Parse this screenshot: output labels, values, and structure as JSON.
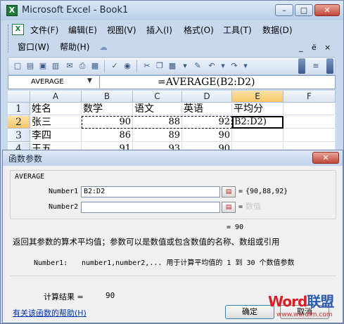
{
  "window": {
    "title": "Microsoft Excel - Book1",
    "icon": "excel-icon"
  },
  "menu": {
    "row1": [
      "文件(F)",
      "编辑(E)",
      "视图(V)",
      "插入(I)",
      "格式(O)",
      "工具(T)",
      "数据(D)"
    ],
    "row2": [
      "窗口(W)",
      "帮助(H)"
    ],
    "doc_controls": [
      "_",
      "ё",
      "×"
    ]
  },
  "formula_bar": {
    "name_box": "AVERAGE",
    "formula": "=AVERAGE(B2:D2)"
  },
  "sheet": {
    "columns": [
      "A",
      "B",
      "C",
      "D",
      "E",
      "F"
    ],
    "rows": [
      "1",
      "2",
      "3",
      "4"
    ],
    "data": [
      [
        "姓名",
        "数学",
        "语文",
        "英语",
        "平均分",
        ""
      ],
      [
        "张三",
        "90",
        "88",
        "92",
        "B2:D2)",
        ""
      ],
      [
        "李四",
        "86",
        "89",
        "90",
        "",
        ""
      ],
      [
        "王五",
        "91",
        "93",
        "90",
        "",
        ""
      ]
    ],
    "selected_column": "E",
    "selected_row": "2"
  },
  "dialog": {
    "title": "函数参数",
    "function_name": "AVERAGE",
    "args": [
      {
        "label": "Number1",
        "value": "B2:D2",
        "result": "{90,88,92}"
      },
      {
        "label": "Number2",
        "value": "",
        "result": "数值"
      }
    ],
    "equals": "=",
    "result_line": "= 90",
    "description": "返回其参数的算术平均值；参数可以是数值或包含数值的名称、数组或引用",
    "arg_desc_name": "Number1:",
    "arg_desc_text": "number1,number2,... 用于计算平均值的 1 到 30 个数值参数",
    "calc_label": "计算结果 =",
    "calc_value": "90",
    "help_link": "有关该函数的帮助(H)",
    "ok": "确定",
    "cancel": "取消"
  },
  "watermark": {
    "brand_a": "Word",
    "brand_b": "联盟",
    "url": "www.wordlm.com"
  }
}
